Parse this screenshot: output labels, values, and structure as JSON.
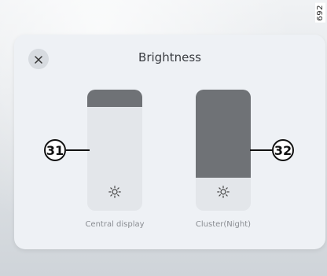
{
  "reference_code": "692",
  "dialog": {
    "title": "Brightness",
    "close_icon": "close-icon"
  },
  "sliders": [
    {
      "label": "Central display",
      "level": 0.14,
      "icon": "brightness-icon",
      "callout": "31"
    },
    {
      "label": "Cluster(Night)",
      "level": 0.73,
      "icon": "brightness-icon",
      "callout": "32"
    }
  ],
  "colors": {
    "dialog_bg": "#eef1f5",
    "slider_track": "#e3e6ea",
    "slider_fill": "#6f7276",
    "text_primary": "#3a3d42",
    "text_secondary": "#8a8d92"
  }
}
